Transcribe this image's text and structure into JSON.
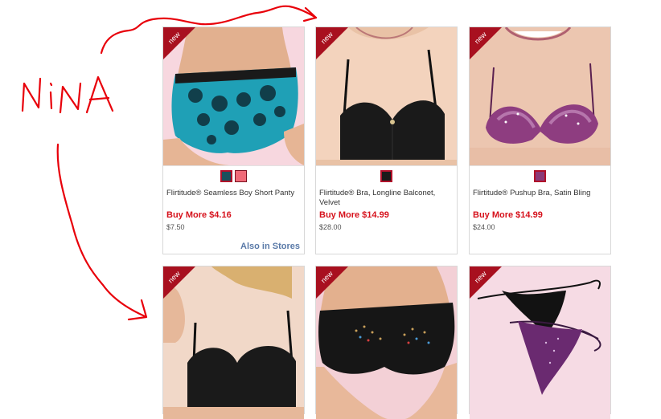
{
  "annotation": {
    "text": "NiNA",
    "color": "#e8000a"
  },
  "badge_label": "new",
  "products": [
    {
      "title": "Flirtitude® Seamless Boy Short Panty",
      "price": "Buy More $4.16",
      "original": "$7.50",
      "store_link": "Also in Stores",
      "swatches": [
        "#1a4f5c",
        "#ef6a78"
      ]
    },
    {
      "title": "Flirtitude® Bra, Longline Balconet, Velvet",
      "price": "Buy More $14.99",
      "original": "$28.00",
      "swatches": [
        "#1a1a1a"
      ]
    },
    {
      "title": "Flirtitude® Pushup Bra, Satin Bling",
      "price": "Buy More $14.99",
      "original": "$24.00",
      "swatches": [
        "#8a3a78"
      ]
    }
  ],
  "colors": {
    "price_red": "#d6121c",
    "link_blue": "#5a7aa8",
    "badge_red": "#a8101f"
  }
}
